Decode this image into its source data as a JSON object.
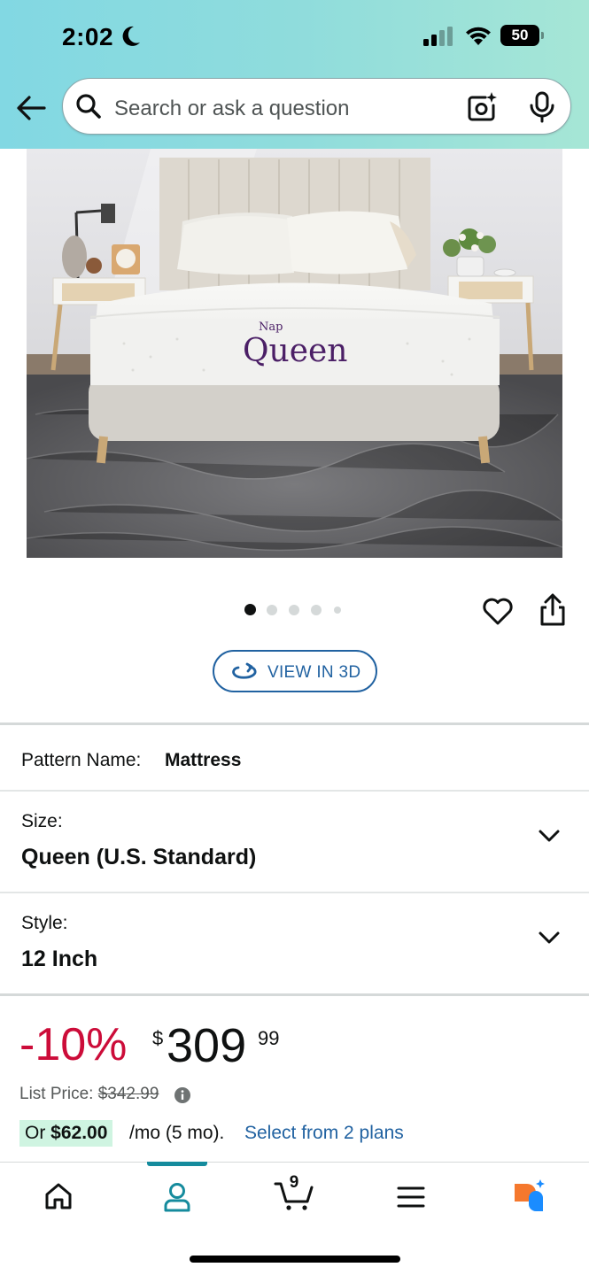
{
  "status_bar": {
    "time": "2:02",
    "battery": "50"
  },
  "header": {
    "search_placeholder": "Search or ask a question"
  },
  "product": {
    "image_brand_text_small": "Nap",
    "image_brand_text_large": "Queen",
    "carousel_total_dots": 5,
    "carousel_active_index": 0,
    "view_in_3d_label": "VIEW IN 3D"
  },
  "variations": {
    "pattern_label": "Pattern Name:",
    "pattern_value": "Mattress",
    "size_label": "Size:",
    "size_value": "Queen (U.S. Standard)",
    "style_label": "Style:",
    "style_value": "12 Inch"
  },
  "price": {
    "discount": "-10%",
    "currency_symbol": "$",
    "whole": "309",
    "fraction": "99",
    "list_price_label": "List Price:",
    "list_price_value": "$342.99",
    "installment_prefix": "Or",
    "installment_amount": "$62.00",
    "installment_term": "/mo (5 mo).",
    "installment_link": "Select from 2 plans"
  },
  "tab_bar": {
    "cart_count": "9",
    "active_tab": "account"
  },
  "colors": {
    "header_gradient_start": "#82d8e3",
    "header_gradient_end": "#a6e6d6",
    "discount_red": "#cc0c39",
    "link_blue": "#2162a1",
    "active_tab_teal": "#158b9d",
    "installment_highlight": "#cff4e1",
    "rufus_orange": "#f5782d",
    "rufus_blue": "#1a8cff"
  }
}
